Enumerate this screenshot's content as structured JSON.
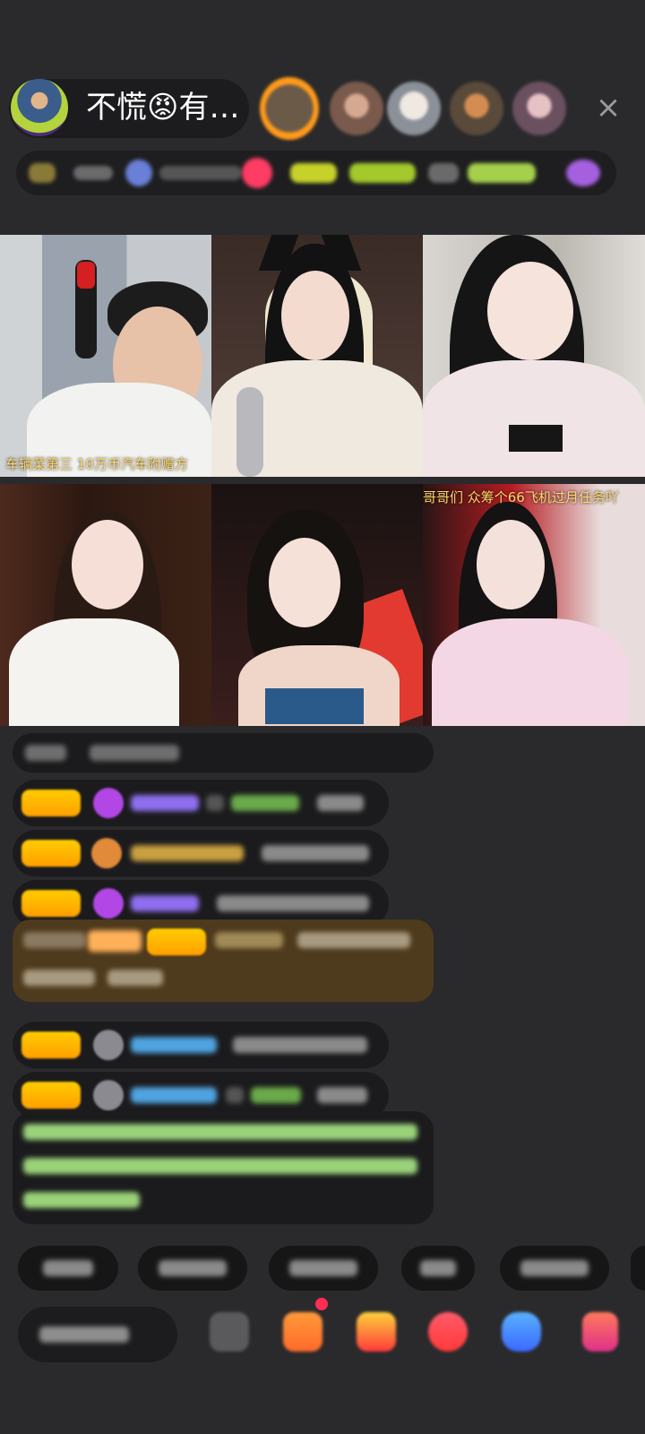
{
  "header": {
    "host_name": "不慌😡有…",
    "close_icon": "×"
  },
  "tiles": {
    "t1_caption": "车辆菜第三 10万币汽车附赠方",
    "t6_caption": "哥哥们 众筹个66飞机过月任务吖"
  },
  "colors": {
    "background": "#2a2a2c",
    "badge": "#ffb000",
    "name_purple": "#8f6ff0",
    "name_blue": "#4fa3e0",
    "notice_green": "#9ad27a",
    "special_bg": "#4e3a1c"
  }
}
